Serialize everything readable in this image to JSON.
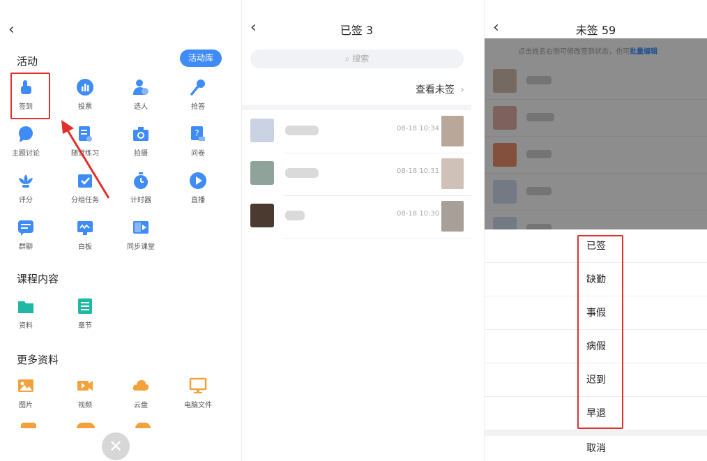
{
  "panel1": {
    "back_glyph": "‹",
    "section_activity": "活动",
    "activity_lib_button": "活动库",
    "activities": [
      {
        "label": "签到",
        "icon": "checkin-hand-icon",
        "color": "#3f8cf7"
      },
      {
        "label": "投票",
        "icon": "vote-chart-icon",
        "color": "#3f8cf7"
      },
      {
        "label": "选人",
        "icon": "select-person-icon",
        "color": "#3f8cf7"
      },
      {
        "label": "抢答",
        "icon": "microphone-icon",
        "color": "#3f8cf7"
      },
      {
        "label": "主题讨论",
        "icon": "discussion-bubble-icon",
        "color": "#3f8cf7"
      },
      {
        "label": "随堂练习",
        "icon": "practice-doc-icon",
        "color": "#3f8cf7"
      },
      {
        "label": "拍摄",
        "icon": "camera-icon",
        "color": "#3f8cf7"
      },
      {
        "label": "问卷",
        "icon": "questionnaire-icon",
        "color": "#3f8cf7"
      },
      {
        "label": "评分",
        "icon": "rating-lotus-icon",
        "color": "#3f8cf7"
      },
      {
        "label": "分组任务",
        "icon": "group-task-icon",
        "color": "#3f8cf7"
      },
      {
        "label": "计时器",
        "icon": "timer-icon",
        "color": "#3f8cf7"
      },
      {
        "label": "直播",
        "icon": "live-play-icon",
        "color": "#3f8cf7"
      },
      {
        "label": "群聊",
        "icon": "group-chat-icon",
        "color": "#3f8cf7"
      },
      {
        "label": "白板",
        "icon": "whiteboard-icon",
        "color": "#3f8cf7"
      },
      {
        "label": "同步课堂",
        "icon": "sync-class-icon",
        "color": "#3f8cf7"
      }
    ],
    "section_course": "课程内容",
    "course_items": [
      {
        "label": "资料",
        "icon": "folder-icon",
        "color": "#1fb8a4"
      },
      {
        "label": "章节",
        "icon": "chapter-list-icon",
        "color": "#1fb8a4"
      }
    ],
    "section_more": "更多资料",
    "more_items": [
      {
        "label": "图片",
        "icon": "image-icon",
        "color": "#f3a13a"
      },
      {
        "label": "视频",
        "icon": "video-icon",
        "color": "#f3a13a"
      },
      {
        "label": "云盘",
        "icon": "cloud-icon",
        "color": "#f3a13a"
      },
      {
        "label": "电脑文件",
        "icon": "computer-icon",
        "color": "#f3a13a"
      }
    ],
    "close_glyph": "✕",
    "annotation_color": "#e0302a"
  },
  "panel2": {
    "back_glyph": "‹",
    "title": "已签 3",
    "search_placeholder": "搜索",
    "see_unsigned": "查看未签",
    "see_unsigned_chevron": "›",
    "rows": [
      {
        "time": "08-18 10:34",
        "avatar_color": "#c9d3e3",
        "photo_color": "#b9a89a"
      },
      {
        "time": "08-18 10:31",
        "avatar_color": "#8fa39a",
        "photo_color": "#cfc1b8"
      },
      {
        "time": "08-18 10:30",
        "avatar_color": "#4a3a30",
        "photo_color": "#a79f98"
      }
    ]
  },
  "panel3": {
    "back_glyph": "‹",
    "title": "未签 59",
    "hint_text": "点击姓名右侧可修改签到状态，也可",
    "hint_link": "批量编辑",
    "list_avatar_colors": [
      "#c8b7a8",
      "#d9a7a0",
      "#e08a6a",
      "#c9d3e3",
      "#c9d3e3"
    ],
    "options": [
      "已签",
      "缺勤",
      "事假",
      "病假",
      "迟到",
      "早退"
    ],
    "cancel": "取消"
  }
}
